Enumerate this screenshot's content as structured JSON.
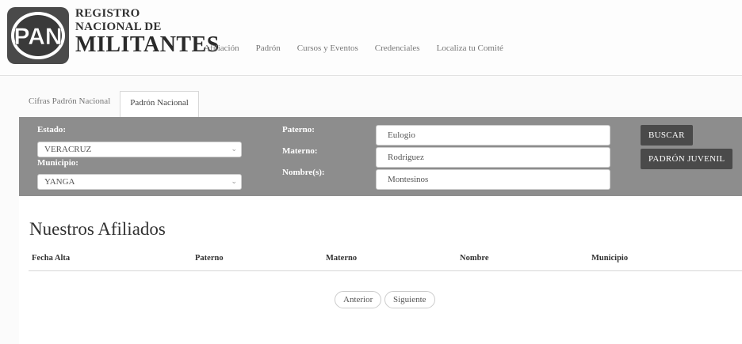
{
  "header": {
    "logo_text": "PAN",
    "brand_line1": "REGISTRO",
    "brand_line2": "NACIONAL DE",
    "brand_line3": "MILITANTES",
    "nav": [
      "Afiliación",
      "Padrón",
      "Cursos y Eventos",
      "Credenciales",
      "Localiza tu Comité"
    ]
  },
  "tabs": [
    {
      "label": "Cifras Padrón Nacional",
      "active": false
    },
    {
      "label": "Padrón Nacional",
      "active": true
    }
  ],
  "filters": {
    "estado_label": "Estado:",
    "estado_value": "VERACRUZ",
    "municipio_label": "Municipio:",
    "municipio_value": "YANGA",
    "paterno_label": "Paterno:",
    "paterno_value": "Eulogio",
    "materno_label": "Materno:",
    "materno_value": "Rodriguez",
    "nombre_label": "Nombre(s):",
    "nombre_value": "Montesinos",
    "buscar_label": "BUSCAR",
    "juvenil_label": "PADRÓN JUVENIL"
  },
  "results": {
    "title": "Nuestros Afiliados",
    "columns": [
      "Fecha Alta",
      "Paterno",
      "Materno",
      "Nombre",
      "Municipio"
    ],
    "prev_label": "Anterior",
    "next_label": "Siguiente"
  },
  "colors": {
    "panel": "#8d8d8d",
    "button": "#4a4a4a"
  }
}
